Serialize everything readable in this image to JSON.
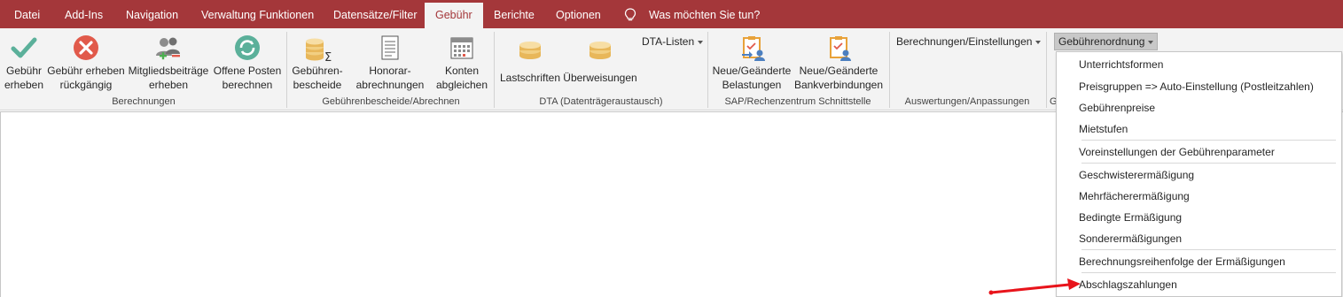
{
  "tabs": {
    "datei": "Datei",
    "addins": "Add-Ins",
    "navigation": "Navigation",
    "verwaltung": "Verwaltung Funktionen",
    "datensaetze": "Datensätze/Filter",
    "gebuehr": "Gebühr",
    "berichte": "Berichte",
    "optionen": "Optionen"
  },
  "tell_me": "Was möchten Sie tun?",
  "ribbon": {
    "berechnungen": {
      "label": "Berechnungen",
      "gebuehr_erheben_1": "Gebühr",
      "gebuehr_erheben_2": "erheben",
      "rueckgaengig_1": "Gebühr erheben",
      "rueckgaengig_2": "rückgängig",
      "mitglied_1": "Mitgliedsbeiträge",
      "mitglied_2": "erheben",
      "offene_1": "Offene Posten",
      "offene_2": "berechnen"
    },
    "bescheide": {
      "label": "Gebührenbescheide/Abrechnen",
      "gebuehren_1": "Gebühren-",
      "gebuehren_2": "bescheide",
      "honorar_1": "Honorar-",
      "honorar_2": "abrechnungen",
      "konten_1": "Konten",
      "konten_2": "abgleichen"
    },
    "dta": {
      "label": "DTA (Datenträgeraustausch)",
      "lastschriften": "Lastschriften",
      "ueberweisungen": "Überweisungen",
      "dta_listen": "DTA-Listen"
    },
    "sap": {
      "label": "SAP/Rechenzentrum Schnittstelle",
      "belastungen_1": "Neue/Geänderte",
      "belastungen_2": "Belastungen",
      "bank_1": "Neue/Geänderte",
      "bank_2": "Bankverbindungen"
    },
    "auswertungen": {
      "label": "Auswertungen/Anpassungen",
      "berechnungen_einstellungen": "Berechnungen/Einstellungen"
    },
    "gebuehrenordnung": {
      "label_partial": "G",
      "button": "Gebührenordnung"
    }
  },
  "menu": {
    "items": [
      "Unterrichtsformen",
      "Preisgruppen => Auto-Einstellung (Postleitzahlen)",
      "Gebührenpreise",
      "Mietstufen",
      "Voreinstellungen der Gebührenparameter",
      "Geschwisterermäßigung",
      "Mehrfächerermäßigung",
      "Bedingte Ermäßigung",
      "Sonderermäßigungen",
      "Berechnungsreihenfolge der Ermäßigungen",
      "Abschlagszahlungen"
    ]
  },
  "colors": {
    "accent": "#a4373a",
    "ribbon_bg": "#f3f3f3",
    "annotation_arrow": "#e8141b"
  }
}
